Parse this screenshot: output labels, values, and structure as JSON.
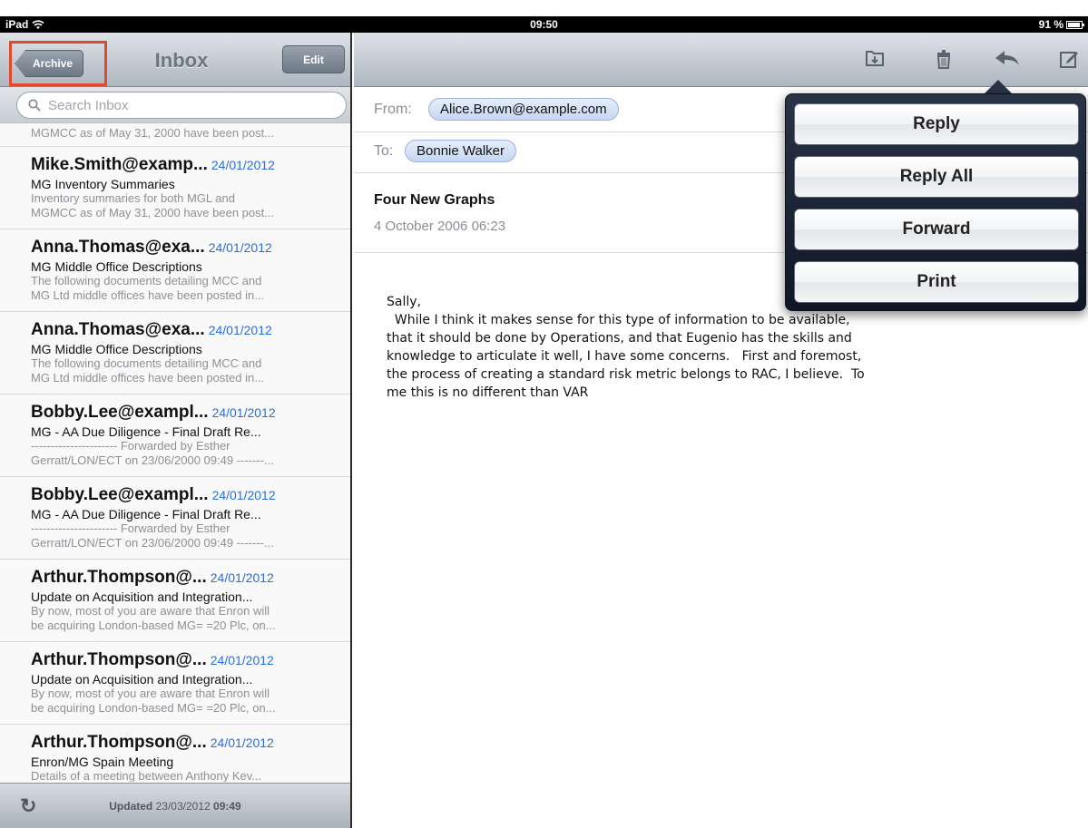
{
  "status_bar": {
    "device": "iPad",
    "time": "09:50",
    "battery": "91 %"
  },
  "master": {
    "back_label": "Archive",
    "title": "Inbox",
    "edit_label": "Edit",
    "search_placeholder": "Search Inbox",
    "partial_preview": "MGMCC as of May 31, 2000 have been post...",
    "messages": [
      {
        "sender": "Mike.Smith@examp...",
        "date": "24/01/2012",
        "subject": "MG Inventory Summaries",
        "preview1": "Inventory summaries for both MGL and",
        "preview2": "MGMCC as of May 31, 2000 have been post..."
      },
      {
        "sender": "Anna.Thomas@exa...",
        "date": "24/01/2012",
        "subject": "MG Middle Office Descriptions",
        "preview1": "The following documents detailing MCC and",
        "preview2": "MG Ltd middle offices have been posted in..."
      },
      {
        "sender": "Anna.Thomas@exa...",
        "date": "24/01/2012",
        "subject": "MG Middle Office Descriptions",
        "preview1": "The following documents detailing MCC and",
        "preview2": "MG Ltd middle offices have been posted in..."
      },
      {
        "sender": "Bobby.Lee@exampl...",
        "date": "24/01/2012",
        "subject": "MG - AA Due Diligence - Final Draft Re...",
        "preview1": "---------------------- Forwarded by Esther",
        "preview2": "Gerratt/LON/ECT on 23/06/2000 09:49 -------..."
      },
      {
        "sender": "Bobby.Lee@exampl...",
        "date": "24/01/2012",
        "subject": "MG - AA Due Diligence - Final Draft Re...",
        "preview1": "---------------------- Forwarded by Esther",
        "preview2": "Gerratt/LON/ECT on 23/06/2000 09:49 -------..."
      },
      {
        "sender": "Arthur.Thompson@...",
        "date": "24/01/2012",
        "subject": "Update on Acquisition and Integration...",
        "preview1": "By now, most of you are aware that Enron will",
        "preview2": "be acquiring London-based MG= =20 Plc, on..."
      },
      {
        "sender": "Arthur.Thompson@...",
        "date": "24/01/2012",
        "subject": "Update on Acquisition and Integration...",
        "preview1": "By now, most of you are aware that Enron will",
        "preview2": "be acquiring London-based MG= =20 Plc, on..."
      },
      {
        "sender": "Arthur.Thompson@...",
        "date": "24/01/2012",
        "subject": "Enron/MG Spain Meeting",
        "preview1": "Details of a meeting between Anthony Kev...",
        "preview2": ""
      }
    ],
    "updated_label": "Updated",
    "updated_date": "23/03/2012",
    "updated_time": "09:49"
  },
  "detail": {
    "from_label": "From:",
    "from": "Alice.Brown@example.com",
    "to_label": "To:",
    "to": "Bonnie Walker",
    "subject": "Four New Graphs",
    "date": "4 October 2006 06:23",
    "body": "Sally,\n  While I think it makes sense for this type of information to be available,\nthat it should be done by Operations, and that Eugenio has the skills and\nknowledge to articulate it well, I have some concerns.   First and foremost,\nthe process of creating a standard risk metric belongs to RAC, I believe.  To\nme this is no different than VAR"
  },
  "toolbar_icons": [
    "move-folder-icon",
    "trash-icon",
    "reply-icon",
    "compose-icon"
  ],
  "popover": {
    "reply": "Reply",
    "reply_all": "Reply All",
    "forward": "Forward",
    "print": "Print"
  }
}
